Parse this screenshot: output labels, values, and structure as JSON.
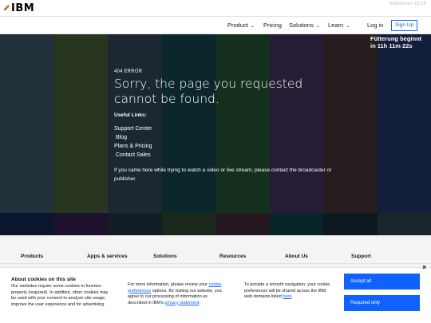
{
  "masthead": {
    "logo": "IBM",
    "top_right": "Hebsbeiten 18:18"
  },
  "nav": {
    "items": [
      {
        "label": "Product",
        "caret": true
      },
      {
        "label": "Pricing",
        "caret": false
      },
      {
        "label": "Solutions",
        "caret": true
      },
      {
        "label": "Learn",
        "caret": true
      },
      {
        "label": "Log in",
        "caret": false
      }
    ],
    "signup": "Sign Up"
  },
  "hero": {
    "countdown_line1": "Fütterung beginnt",
    "countdown_line2": "in 11h 11m 22s",
    "error_label": "404 ERROR",
    "error_title": "Sorry, the page you requested cannot be found.",
    "links_heading": "Useful Links:",
    "links": [
      "Support Center",
      "Blog",
      "Plans & Pricing",
      "Contact Sales"
    ],
    "paragraph": "If you came here while trying to watch a video or live stream, please contact the broadcaster or publisher.",
    "bar_colors": [
      "#354a58",
      "#3e5431",
      "#2a3e4c",
      "#113c42",
      "#1f4a2c",
      "#392d52",
      "#3d2b2f",
      "#1d2e5a"
    ],
    "low_bar_colors": [
      "#0e2247",
      "#2f1b47",
      "#1b2e3a",
      "#283c28",
      "#3a2632",
      "#0d3b3e",
      "#152530",
      "#2d3a44"
    ]
  },
  "footer": {
    "columns": [
      "Products",
      "Apps & services",
      "Solutions",
      "Resources",
      "About Us",
      "Support"
    ]
  },
  "cookie": {
    "title": "About cookies on this site",
    "text1": "Our websites require some cookies to function properly (required). In addition, other cookies may be used with your consent to analyze site usage, improve the user experience and for advertising.",
    "text2_pre": "For more information, please review your",
    "text2_link1": "cookie preferences",
    "text2_mid": "options. By visiting our website, you agree to our processing of information as described in IBM's",
    "text2_link2": "privacy statement",
    "text3_pre": "To provide a smooth navigation, your cookie preferences will be shared across the IBM web domains listed",
    "text3_link": "here",
    "accept_all": "Accept all",
    "required_only": "Required only",
    "close": "×"
  }
}
